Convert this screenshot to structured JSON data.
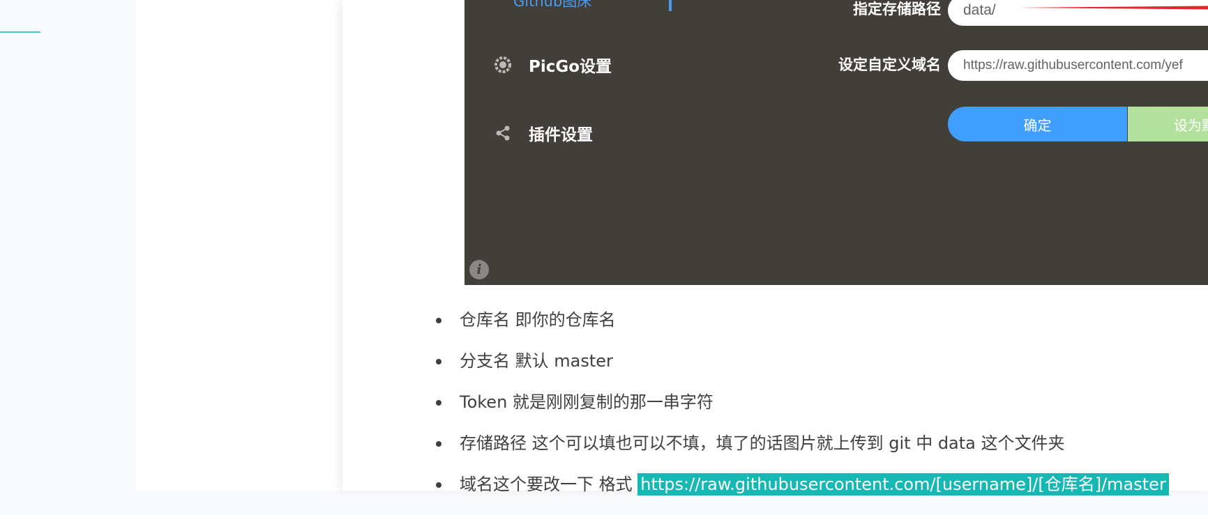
{
  "screenshot": {
    "nav_top_label": "Github图床",
    "nav_items": [
      {
        "icon": "gear-icon",
        "label": "PicGo设置"
      },
      {
        "icon": "share-icon",
        "label": "插件设置"
      }
    ],
    "form": {
      "path_label": "指定存储路径",
      "path_value": "data/",
      "domain_label": "设定自定义域名",
      "domain_value": "https://raw.githubusercontent.com/yef",
      "confirm_label": "确定",
      "default_label": "设为默认"
    },
    "info_icon": "i"
  },
  "list": [
    {
      "text": "仓库名 即你的仓库名"
    },
    {
      "text": "分支名 默认 master"
    },
    {
      "text": "Token 就是刚刚复制的那一串字符"
    },
    {
      "text": "存储路径 这个可以填也可以不填，填了的话图片就上传到 git 中 data 这个文件夹"
    },
    {
      "text": "域名这个要改一下 格式 ",
      "highlight": "https://raw.githubusercontent.com/[username]/[仓库名]/master"
    }
  ],
  "colors": {
    "accent_blue": "#409eff",
    "highlight_teal": "#17b8b4",
    "screenshot_bg": "#423e3a"
  }
}
